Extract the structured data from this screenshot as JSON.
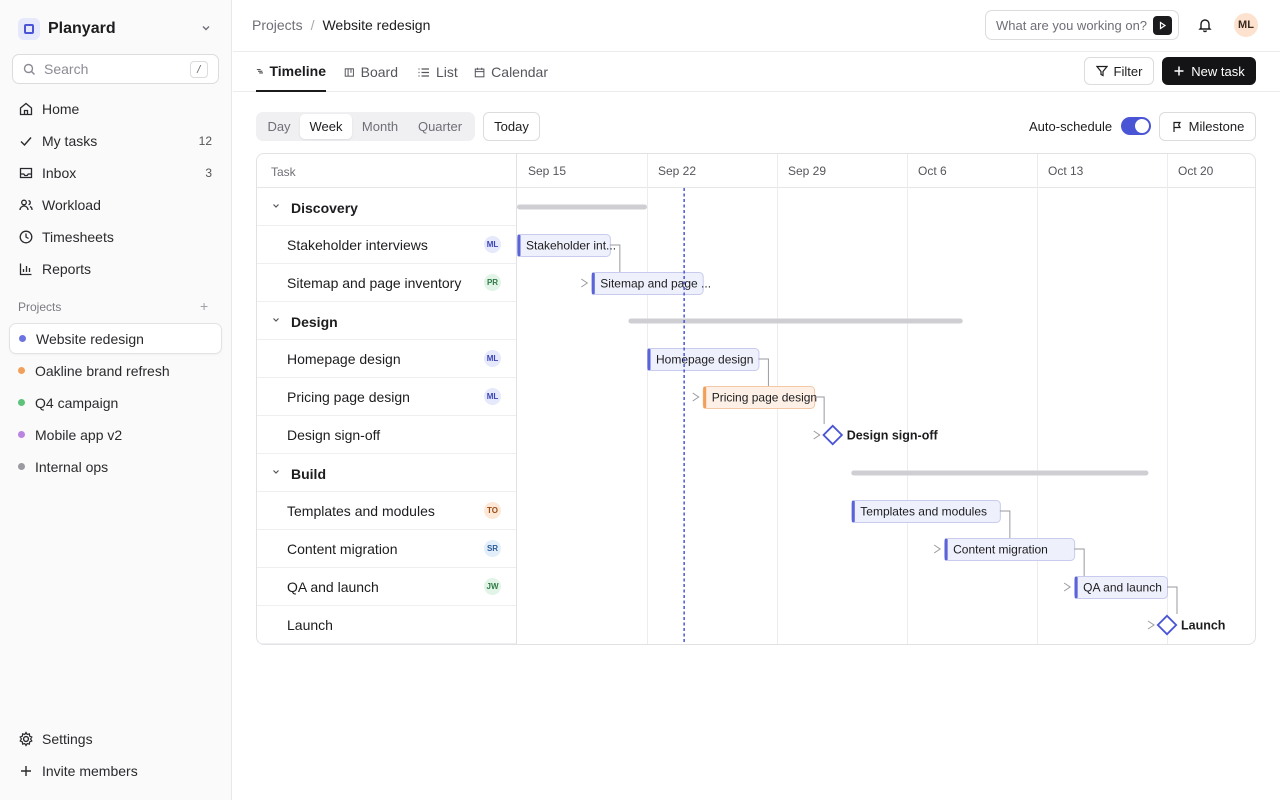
{
  "workspace": {
    "name": "Planyard"
  },
  "search": {
    "placeholder": "Search",
    "shortcut": "/"
  },
  "nav": [
    {
      "label": "Home",
      "icon": "home-icon"
    },
    {
      "label": "My tasks",
      "icon": "check-icon",
      "count": "12"
    },
    {
      "label": "Inbox",
      "icon": "inbox-icon",
      "count": "3"
    },
    {
      "label": "Workload",
      "icon": "users-icon"
    },
    {
      "label": "Timesheets",
      "icon": "clock-icon"
    },
    {
      "label": "Reports",
      "icon": "bar-chart-icon"
    }
  ],
  "projects_title": "Projects",
  "projects": [
    {
      "label": "Website redesign",
      "color": "#6b74e0",
      "active": true
    },
    {
      "label": "Oakline brand refresh",
      "color": "#f0a05a"
    },
    {
      "label": "Q4 campaign",
      "color": "#5dc27a"
    },
    {
      "label": "Mobile app v2",
      "color": "#b985e0"
    },
    {
      "label": "Internal ops",
      "color": "#9a9aa0"
    }
  ],
  "footer": {
    "settings": "Settings",
    "invite": "Invite members"
  },
  "breadcrumb": {
    "parent": "Projects",
    "current": "Website redesign"
  },
  "ask": {
    "placeholder": "What are you working on?"
  },
  "user": {
    "initials": "ML"
  },
  "tabs": [
    {
      "label": "Timeline",
      "icon": "timeline-icon",
      "active": true
    },
    {
      "label": "Board",
      "icon": "board-icon"
    },
    {
      "label": "List",
      "icon": "list-icon"
    },
    {
      "label": "Calendar",
      "icon": "calendar-icon"
    }
  ],
  "actions": {
    "filter": "Filter",
    "new_task": "New task"
  },
  "scale": {
    "options": [
      "Day",
      "Week",
      "Month",
      "Quarter"
    ],
    "selected": "Week"
  },
  "today_label": "Today",
  "auto_schedule": {
    "label": "Auto-schedule",
    "enabled": true
  },
  "milestone_label": "Milestone",
  "gantt": {
    "task_header": "Task",
    "weeks": [
      "Sep 15",
      "Sep 22",
      "Sep 29",
      "Oct 6",
      "Oct 13",
      "Oct 20"
    ],
    "today": "Sep 24",
    "groups": [
      {
        "name": "Discovery",
        "start": "Sep 15",
        "end": "Sep 22",
        "tasks": [
          {
            "name": "Stakeholder interviews",
            "bar_label": "Stakeholder int...",
            "assignee": "ML",
            "start": "Sep 15",
            "end": "Sep 20",
            "color": "#5b63d8"
          },
          {
            "name": "Sitemap and page inventory",
            "bar_label": "Sitemap and page ...",
            "assignee": "PR",
            "start": "Sep 19",
            "end": "Sep 25",
            "color": "#5b63d8"
          }
        ]
      },
      {
        "name": "Design",
        "start": "Sep 21",
        "end": "Oct 9",
        "tasks": [
          {
            "name": "Homepage design",
            "bar_label": "Homepage design",
            "assignee": "ML",
            "start": "Sep 22",
            "end": "Sep 28",
            "color": "#5b63d8"
          },
          {
            "name": "Pricing page design",
            "bar_label": "Pricing page design",
            "assignee": "ML",
            "start": "Sep 25",
            "end": "Oct 1",
            "color": "#f0a05a"
          },
          {
            "name": "Design sign-off",
            "milestone": true,
            "date": "Oct 2",
            "label": "Design sign-off"
          }
        ]
      },
      {
        "name": "Build",
        "start": "Oct 3",
        "end": "Oct 19",
        "tasks": [
          {
            "name": "Templates and modules",
            "bar_label": "Templates and modules",
            "assignee": "TO",
            "start": "Oct 3",
            "end": "Oct 11",
            "color": "#5b63d8"
          },
          {
            "name": "Content migration",
            "bar_label": "Content migration",
            "assignee": "SR",
            "start": "Oct 8",
            "end": "Oct 15",
            "color": "#5b63d8"
          },
          {
            "name": "QA and launch",
            "bar_label": "QA and launch",
            "assignee": "JW",
            "start": "Oct 15",
            "end": "Oct 20",
            "color": "#5b63d8"
          },
          {
            "name": "Launch",
            "milestone": true,
            "date": "Oct 20",
            "label": "Launch"
          }
        ]
      }
    ]
  },
  "assignee_colors": {
    "ML": {
      "bg": "#e6e8fb",
      "fg": "#3a44b8"
    },
    "PR": {
      "bg": "#e2f4e7",
      "fg": "#2f7a46"
    },
    "TO": {
      "bg": "#fde8d8",
      "fg": "#9a4b18"
    },
    "SR": {
      "bg": "#e3eefb",
      "fg": "#2c5b99"
    },
    "JW": {
      "bg": "#e2f4e7",
      "fg": "#2f7a46"
    }
  }
}
